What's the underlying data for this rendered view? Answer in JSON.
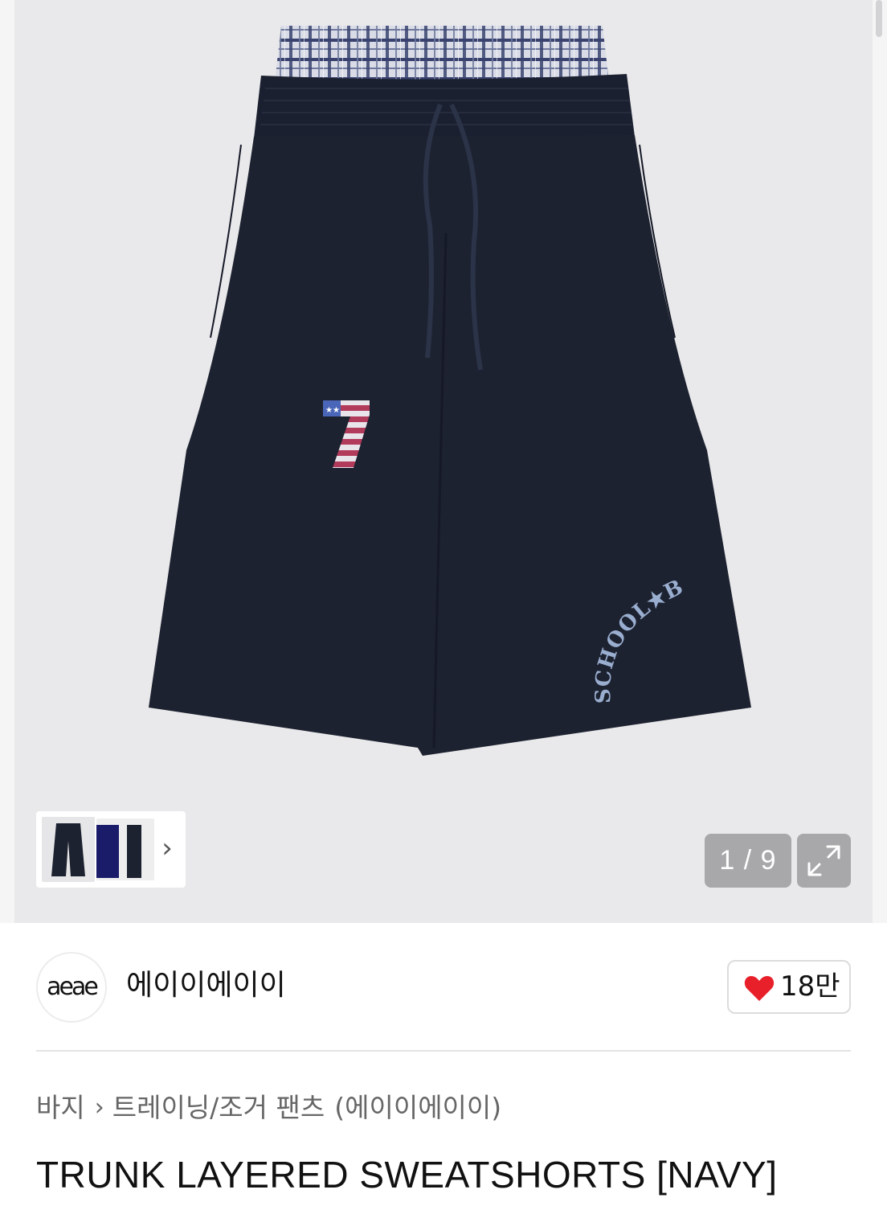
{
  "gallery": {
    "counter": "1 / 9",
    "print_number": "7",
    "print_text": "SCHOOL★BOY"
  },
  "brand": {
    "logo_text": "aeae",
    "name": "에이이에이이"
  },
  "like": {
    "count": "18만"
  },
  "breadcrumb": {
    "category": "바지",
    "separator": "›",
    "subcategory": "트레이닝/조거 팬츠",
    "brand": "(에이이에이이)"
  },
  "product": {
    "title": "TRUNK LAYERED SWEATSHORTS [NAVY]"
  },
  "colors": {
    "hero_bg": "#e9e9eb",
    "shorts": "#1d2230",
    "like_heart": "#e8202a"
  },
  "icons": {
    "next_thumb": "chevron-right-icon",
    "expand": "expand-icon",
    "like": "heart-icon"
  }
}
